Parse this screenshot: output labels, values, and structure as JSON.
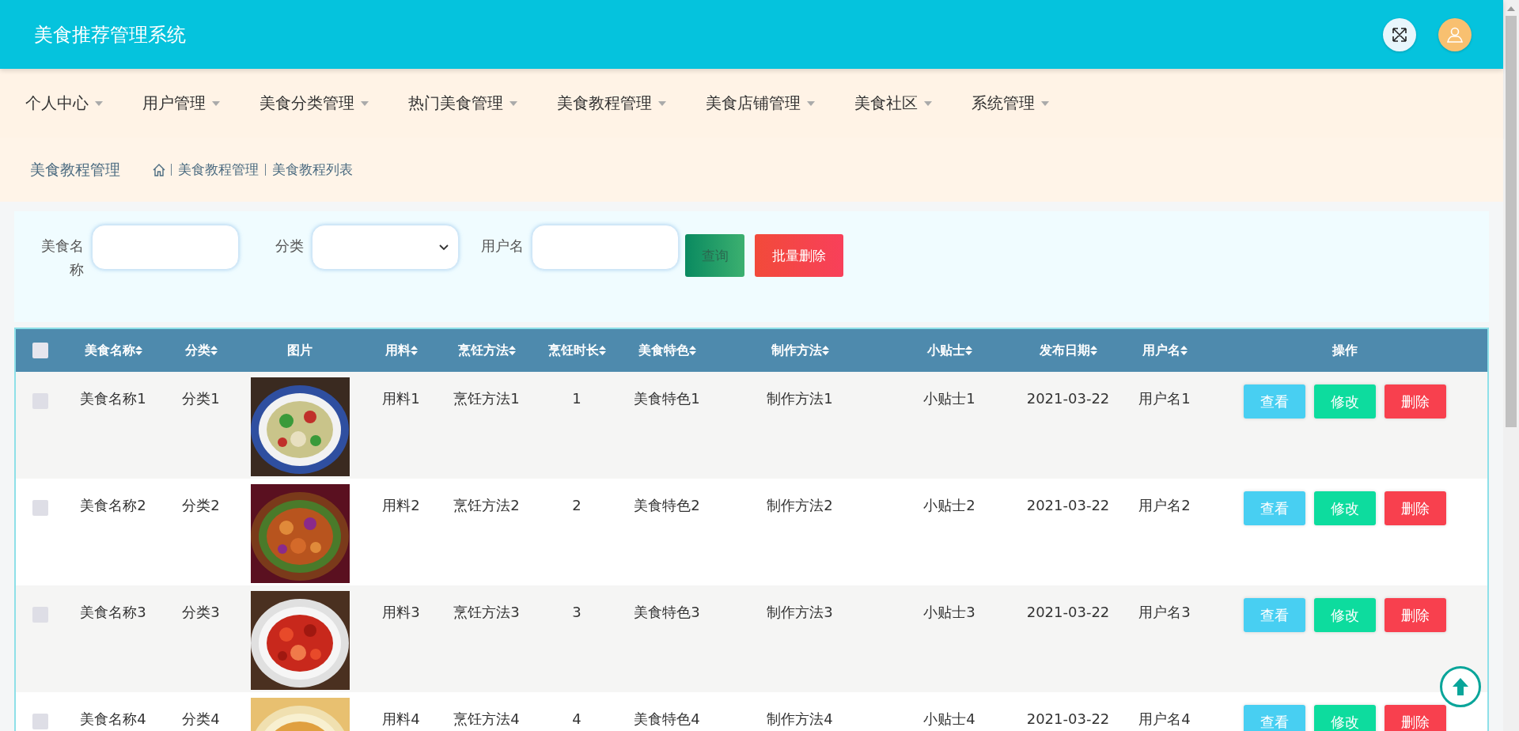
{
  "header": {
    "title": "美食推荐管理系统"
  },
  "nav": [
    {
      "label": "个人中心"
    },
    {
      "label": "用户管理"
    },
    {
      "label": "美食分类管理"
    },
    {
      "label": "热门美食管理"
    },
    {
      "label": "美食教程管理"
    },
    {
      "label": "美食店铺管理"
    },
    {
      "label": "美食社区"
    },
    {
      "label": "系统管理"
    }
  ],
  "breadcrumb": {
    "title": "美食教程管理",
    "items": [
      "美食教程管理",
      "美食教程列表"
    ]
  },
  "search": {
    "fields": [
      {
        "label": "美食名称",
        "kind": "input"
      },
      {
        "label": "分类",
        "kind": "select"
      },
      {
        "label": "用户名",
        "kind": "input"
      }
    ],
    "buttons": [
      {
        "label": "查询",
        "kind": "search"
      },
      {
        "label": "批量删除",
        "kind": "danger"
      }
    ]
  },
  "table": {
    "select_all": {
      "checked": false
    },
    "columns": [
      {
        "label": "美食名称",
        "sortable": true
      },
      {
        "label": "分类",
        "sortable": true
      },
      {
        "label": "图片",
        "sortable": false
      },
      {
        "label": "用料",
        "sortable": true
      },
      {
        "label": "烹饪方法",
        "sortable": true
      },
      {
        "label": "烹饪时长",
        "sortable": true
      },
      {
        "label": "美食特色",
        "sortable": true
      },
      {
        "label": "制作方法",
        "sortable": true
      },
      {
        "label": "小贴士",
        "sortable": true
      },
      {
        "label": "发布日期",
        "sortable": true
      },
      {
        "label": "用户名",
        "sortable": true
      },
      {
        "label": "操作",
        "sortable": false
      }
    ],
    "rows": [
      {
        "checked": false,
        "cells": [
          "美食名称1",
          "分类1",
          {
            "kind": "picture"
          },
          "用料1",
          "烹饪方法1",
          "1",
          "美食特色1",
          "制作方法1",
          "小贴士1",
          "2021-03-22",
          "用户名1"
        ],
        "actions": [
          "查看",
          "修改",
          "删除"
        ]
      },
      {
        "checked": false,
        "cells": [
          "美食名称2",
          "分类2",
          {
            "kind": "picture"
          },
          "用料2",
          "烹饪方法2",
          "2",
          "美食特色2",
          "制作方法2",
          "小贴士2",
          "2021-03-22",
          "用户名2"
        ],
        "actions": [
          "查看",
          "修改",
          "删除"
        ]
      },
      {
        "checked": false,
        "cells": [
          "美食名称3",
          "分类3",
          {
            "kind": "picture"
          },
          "用料3",
          "烹饪方法3",
          "3",
          "美食特色3",
          "制作方法3",
          "小贴士3",
          "2021-03-22",
          "用户名3"
        ],
        "actions": [
          "查看",
          "修改",
          "删除"
        ]
      },
      {
        "checked": false,
        "cells": [
          "美食名称4",
          "分类4",
          {
            "kind": "picture"
          },
          "用料4",
          "烹饪方法4",
          "4",
          "美食特色4",
          "制作方法4",
          "小贴士4",
          "2021-03-22",
          "用户名4"
        ],
        "actions": [
          "查看",
          "修改",
          "删除"
        ]
      }
    ]
  }
}
